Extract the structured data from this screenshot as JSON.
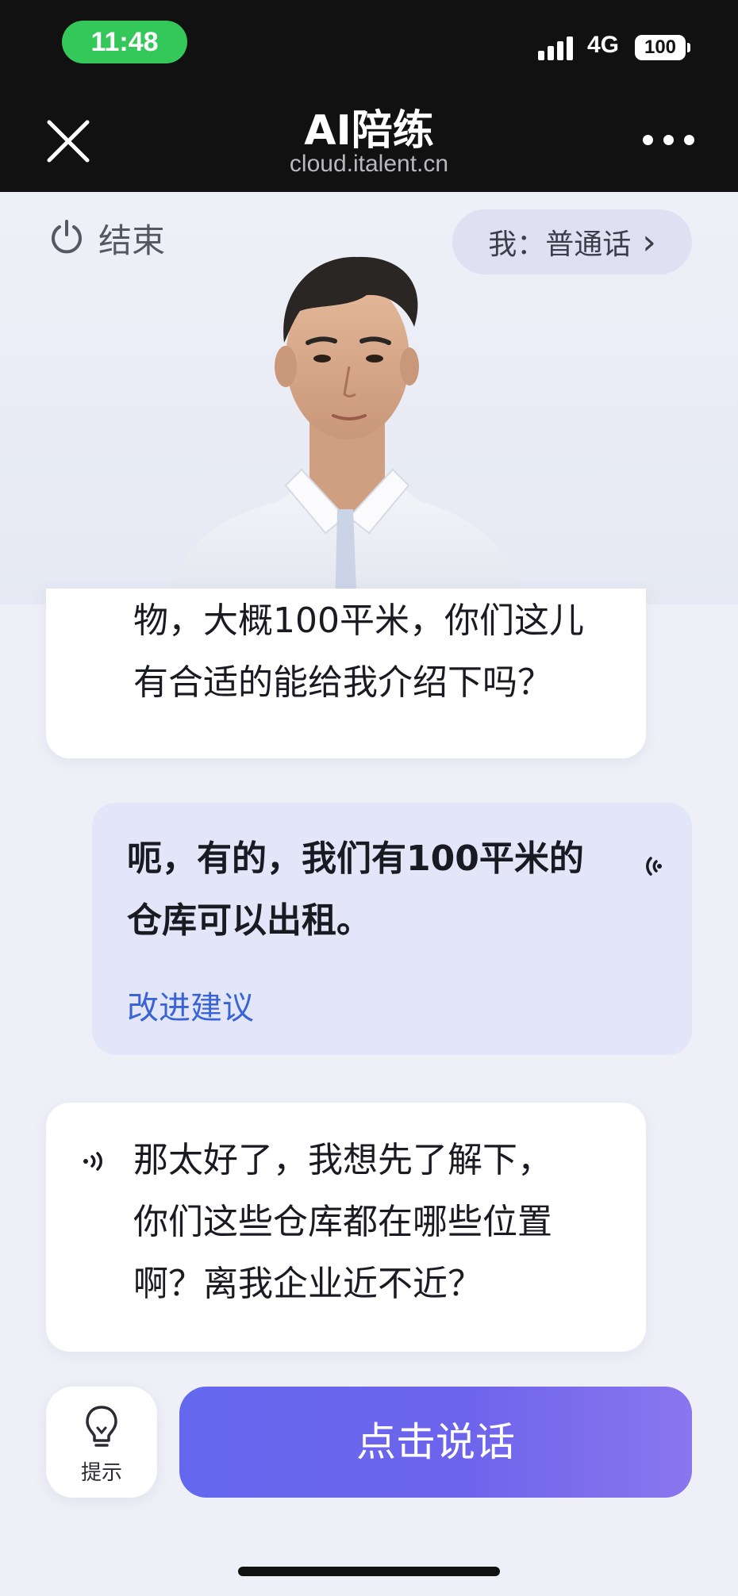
{
  "status_bar": {
    "time": "11:48",
    "network": "4G",
    "battery": "100"
  },
  "nav": {
    "title": "AI陪练",
    "subtitle": "cloud.italent.cn",
    "close_icon": "close-icon",
    "more_icon": "more-icon"
  },
  "header": {
    "end_label": "结束",
    "language_label": "我：普通话",
    "language_chevron": "›"
  },
  "messages": [
    {
      "role": "ai",
      "lines": "物，大概100平米，你们这儿\n有合适的能给我介绍下吗？"
    },
    {
      "role": "user",
      "lines": "呃，有的，我们有100平米的\n仓库可以出租。",
      "suggestion": "改进建议"
    },
    {
      "role": "ai",
      "lines": "那太好了，我想先了解下，\n你们这些仓库都在哪些位置\n啊？离我企业近不近？"
    }
  ],
  "controls": {
    "hint_label": "提示",
    "talk_label": "点击说话"
  },
  "colors": {
    "accent": "#6468ee",
    "link": "#3a63d6",
    "status_green": "#34c759"
  }
}
